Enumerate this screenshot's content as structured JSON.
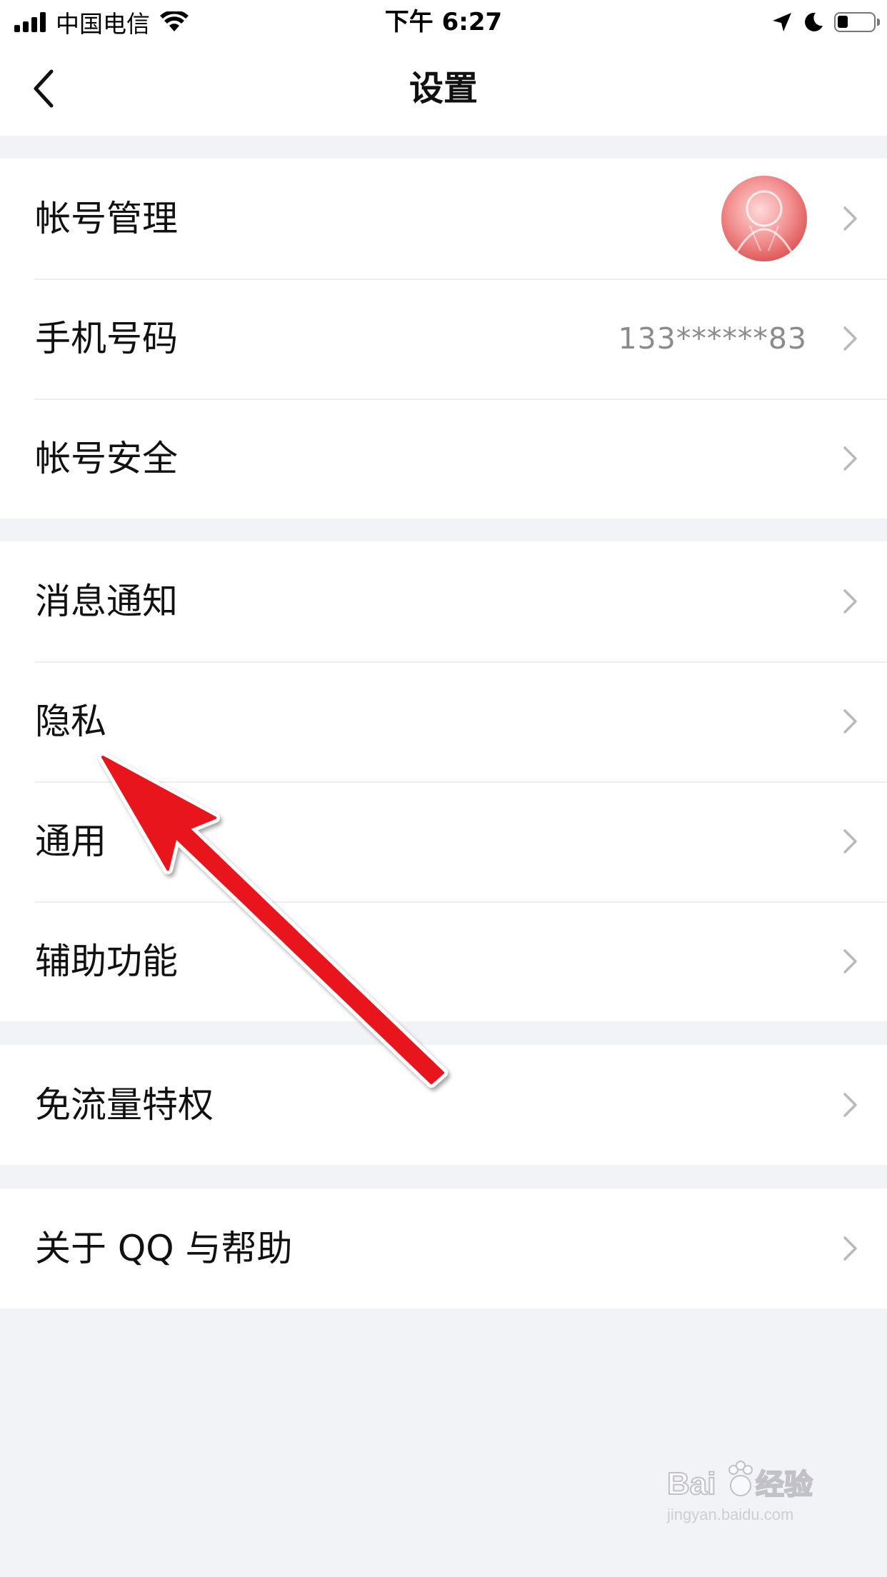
{
  "status_bar": {
    "carrier": "中国电信",
    "time": "下午 6:27"
  },
  "nav": {
    "title": "设置"
  },
  "groups": [
    {
      "items": [
        {
          "label": "帐号管理",
          "icon": "avatar-image"
        },
        {
          "label": "手机号码",
          "value": "133******83"
        },
        {
          "label": "帐号安全"
        }
      ]
    },
    {
      "items": [
        {
          "label": "消息通知"
        },
        {
          "label": "隐私"
        },
        {
          "label": "通用"
        },
        {
          "label": "辅助功能"
        }
      ]
    },
    {
      "items": [
        {
          "label": "免流量特权"
        }
      ]
    },
    {
      "items": [
        {
          "label": "关于 QQ 与帮助"
        }
      ]
    }
  ],
  "watermark": {
    "brand": "Bai",
    "brand_cn": "经验",
    "url": "jingyan.baidu.com"
  },
  "colors": {
    "background": "#f2f3f7",
    "annotation_arrow": "#e8141b",
    "secondary_text": "#8a8a8f"
  }
}
